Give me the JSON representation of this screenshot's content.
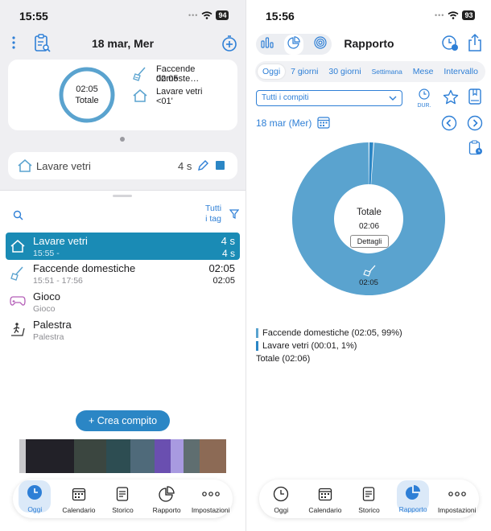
{
  "left": {
    "status": {
      "time": "15:55",
      "battery": "94"
    },
    "header": {
      "date": "18 mar, Mer"
    },
    "summary": {
      "ring_time": "02:05",
      "ring_label": "Totale",
      "items": [
        {
          "name": "Faccende domestiche",
          "name_display": "Faccende domeste…",
          "time": "02:05"
        },
        {
          "name": "Lavare vetri",
          "time": "<01'"
        }
      ]
    },
    "running": {
      "label": "Lavare vetri",
      "time": "4 s"
    },
    "filter": {
      "tags_label_1": "Tutti",
      "tags_label_2": "i tag"
    },
    "tasks": [
      {
        "title": "Lavare vetri",
        "sub": "15:55 -",
        "right1": "4 s",
        "right2": "4 s",
        "active": true
      },
      {
        "title": "Faccende domestiche",
        "sub": "15:51 - 17:56",
        "right1": "02:05",
        "right2": "02:05",
        "active": false
      },
      {
        "title": "Gioco",
        "sub": "Gioco",
        "right1": "",
        "right2": "",
        "active": false
      },
      {
        "title": "Palestra",
        "sub": "Palestra",
        "right1": "",
        "right2": "",
        "active": false
      }
    ],
    "create_button": "+ Crea compito",
    "tabs": [
      {
        "label": "Oggi",
        "icon": "clock-icon"
      },
      {
        "label": "Calendario",
        "icon": "calendar-icon"
      },
      {
        "label": "Storico",
        "icon": "history-icon"
      },
      {
        "label": "Rapporto",
        "icon": "pie-chart-icon"
      },
      {
        "label": "Impostazioni",
        "icon": "more-icon"
      }
    ],
    "active_tab": 0
  },
  "right": {
    "status": {
      "time": "15:56",
      "battery": "93"
    },
    "header": {
      "title": "Rapporto"
    },
    "periods": [
      "Oggi",
      "7 giorni",
      "30 giorni",
      "Settimana",
      "Mese",
      "Intervallo"
    ],
    "selected_period": 0,
    "task_select": "Tutti i compiti",
    "dur_label": "DUR.",
    "date_label": "18 mar (Mer)",
    "chart_data": {
      "type": "pie",
      "style": "donut",
      "center_title": "Totale",
      "center_value": "02:06",
      "center_button": "Dettagli",
      "slice_label": "02:05",
      "slices": [
        {
          "name": "Faccende domestiche",
          "value": 99,
          "duration": "02:05",
          "color": "#5aa3cf"
        },
        {
          "name": "Lavare vetri",
          "value": 1,
          "duration": "00:01",
          "color": "#2b86c5"
        }
      ]
    },
    "legend": [
      "Faccende domestiche (02:05, 99%)",
      "Lavare vetri (00:01, 1%)"
    ],
    "total": "Totale (02:06)",
    "tabs": [
      {
        "label": "Oggi",
        "icon": "clock-icon"
      },
      {
        "label": "Calendario",
        "icon": "calendar-icon"
      },
      {
        "label": "Storico",
        "icon": "history-icon"
      },
      {
        "label": "Rapporto",
        "icon": "pie-chart-icon"
      },
      {
        "label": "Impostazioni",
        "icon": "more-icon"
      }
    ],
    "active_tab": 3
  },
  "colors": {
    "accent": "#2e7fd6",
    "active_row": "#1a8bb5",
    "ring": "#5aa3cf"
  }
}
